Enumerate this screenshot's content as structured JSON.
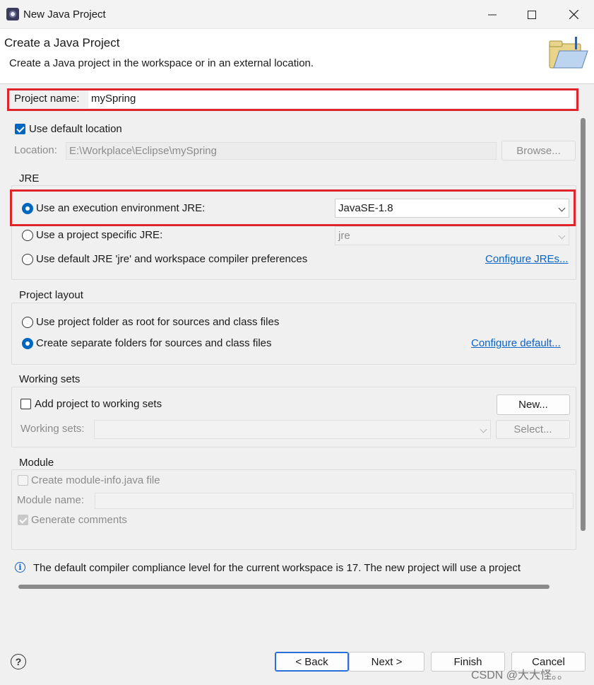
{
  "window": {
    "title": "New Java Project",
    "minimize": "—",
    "maximize": "☐",
    "close": "✕"
  },
  "header": {
    "title": "Create a Java Project",
    "subtitle": "Create a Java project in the workspace or in an external location."
  },
  "project": {
    "name_label": "Project name:",
    "name_value": "mySpring"
  },
  "location": {
    "use_default_label": "Use default location",
    "use_default_checked": true,
    "location_label": "Location:",
    "location_value": "E:\\Workplace\\Eclipse\\mySpring",
    "browse_label": "Browse..."
  },
  "jre": {
    "group_title": "JRE",
    "exec_env_label": "Use an execution environment JRE:",
    "exec_env_value": "JavaSE-1.8",
    "project_specific_label": "Use a project specific JRE:",
    "project_specific_value": "jre",
    "default_jre_label": "Use default JRE 'jre' and workspace compiler preferences",
    "configure_link": "Configure JREs..."
  },
  "layout": {
    "group_title": "Project layout",
    "root_label": "Use project folder as root for sources and class files",
    "separate_label": "Create separate folders for sources and class files",
    "configure_link": "Configure default..."
  },
  "working_sets": {
    "group_title": "Working sets",
    "add_label": "Add project to working sets",
    "new_button": "New...",
    "sets_label": "Working sets:",
    "select_button": "Select..."
  },
  "module": {
    "group_title": "Module",
    "create_label": "Create module-info.java file",
    "name_label": "Module name:",
    "comments_label": "Generate comments"
  },
  "info": {
    "message": "The default compiler compliance level for the current workspace is 17. The new project will use a project"
  },
  "footer": {
    "back": "< Back",
    "next": "Next >",
    "finish": "Finish",
    "cancel": "Cancel",
    "watermark": "CSDN @大大怪。。"
  },
  "colors": {
    "accent": "#0067c0",
    "highlight_box": "#e0242b",
    "link": "#0b63c6"
  }
}
